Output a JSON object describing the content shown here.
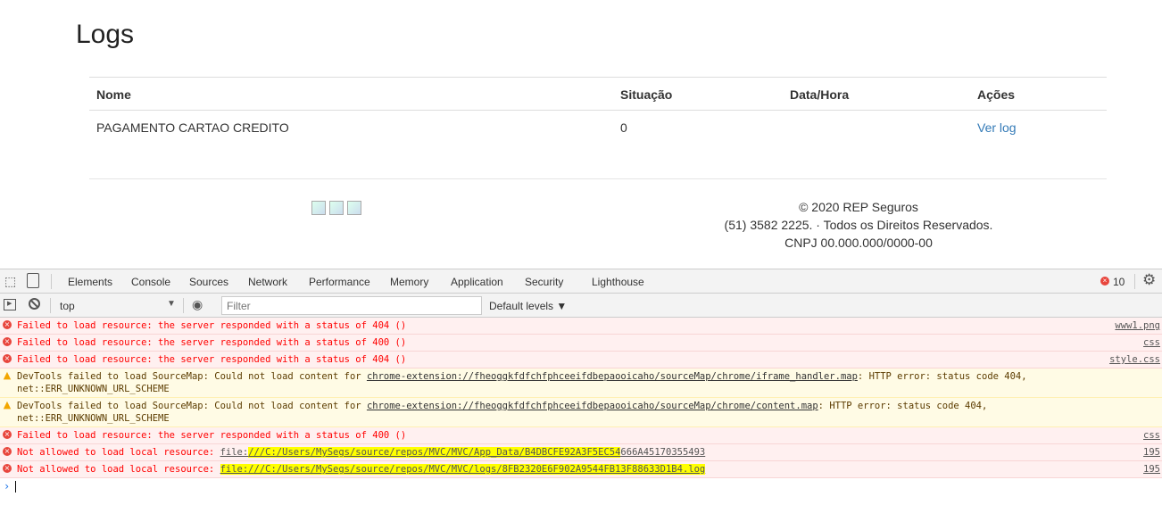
{
  "page": {
    "title": "Logs",
    "table": {
      "headers": [
        "Nome",
        "Situação",
        "Data/Hora",
        "Ações"
      ],
      "rows": [
        {
          "nome": "PAGAMENTO CARTAO CREDITO",
          "situacao": "0",
          "data_hora": "",
          "acao": "Ver log"
        }
      ]
    },
    "footer": {
      "copyright": "© 2020 REP Seguros",
      "phone": "(51) 3582 2225. · Todos os Direitos Reservados.",
      "cnpj": "CNPJ 00.000.000/0000-00"
    }
  },
  "devtools": {
    "tabs": [
      "Elements",
      "Console",
      "Sources",
      "Network",
      "Performance",
      "Memory",
      "Application",
      "Security",
      "Lighthouse"
    ],
    "active_tab": "Console",
    "error_count": "10",
    "context": "top",
    "filter_placeholder": "Filter",
    "levels": "Default levels ▼",
    "messages": [
      {
        "type": "error",
        "text": "Failed to load resource: the server responded with a status of 404 ()",
        "source": "www1.png"
      },
      {
        "type": "error",
        "text": "Failed to load resource: the server responded with a status of 400 ()",
        "source": "css"
      },
      {
        "type": "error",
        "text": "Failed to load resource: the server responded with a status of 404 ()",
        "source": "style.css"
      },
      {
        "type": "warning",
        "pre": "DevTools failed to load SourceMap: Could not load content for ",
        "link": "chrome-extension://fheoggkfdfchfphceeifdbepaooicaho/sourceMap/chrome/iframe_handler.map",
        "post": ": HTTP error: status code 404,",
        "line2": "net::ERR_UNKNOWN_URL_SCHEME"
      },
      {
        "type": "warning",
        "pre": "DevTools failed to load SourceMap: Could not load content for ",
        "link": "chrome-extension://fheoggkfdfchfphceeifdbepaooicaho/sourceMap/chrome/content.map",
        "post": ": HTTP error: status code 404,",
        "line2": "net::ERR_UNKNOWN_URL_SCHEME"
      },
      {
        "type": "error",
        "text": "Failed to load resource: the server responded with a status of 400 ()",
        "source": "css"
      },
      {
        "type": "error",
        "pre": "Not allowed to load local resource: ",
        "link_a": "file:",
        "link_hl": "///C:/Users/MySegs/source/repos/MVC/MVC/App_Data/B4DBCFE92A3F5EC54",
        "link_b": "666A45170355493",
        "source": "195"
      },
      {
        "type": "error",
        "pre": "Not allowed to load local resource: ",
        "link_a": "",
        "link_hl": "file:///C:/Users/MySegs/source/repos/MVC/MVC/logs/8FB2320E6F902A9544FB13F88633D1B4.log",
        "link_b": "",
        "source": "195"
      }
    ],
    "highlight_color": "#ffff00"
  }
}
